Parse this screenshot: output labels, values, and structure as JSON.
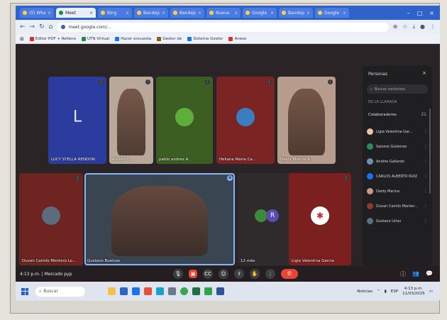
{
  "browser": {
    "tabs": [
      {
        "label": "(5) WhatsA",
        "active": false
      },
      {
        "label": "Meet",
        "active": true
      },
      {
        "label": "Bing",
        "active": false
      },
      {
        "label": "Bandeja",
        "active": false
      },
      {
        "label": "Bandeja",
        "active": false
      },
      {
        "label": "Nueva",
        "active": false
      },
      {
        "label": "Google",
        "active": false
      },
      {
        "label": "Bandeja",
        "active": false
      },
      {
        "label": "Google",
        "active": false
      }
    ],
    "url": "meet.google.com/...",
    "bookmarks": [
      {
        "label": "Editor PDF + Relleno",
        "color": "#d93025"
      },
      {
        "label": "UTN Virtual",
        "color": "#1e8e3e"
      },
      {
        "label": "Hacer encuesta",
        "color": "#1a73e8"
      },
      {
        "label": "Gestor de",
        "color": "#8e5a1e"
      },
      {
        "label": "Sistema Gestor",
        "color": "#1a73e8"
      },
      {
        "label": "Anexo",
        "color": "#d93025"
      }
    ]
  },
  "meet": {
    "participants_grid": [
      {
        "name": "LUCY STELLA RENDON",
        "bg": "#2b3c9e",
        "kind": "letter",
        "letter": "L"
      },
      {
        "name": "Aurelio C...",
        "bg": "#b9a89a",
        "kind": "video"
      },
      {
        "name": "pablo andres A",
        "bg": "#3d5e22",
        "kind": "avatar",
        "avatar_color": "#5fae3a"
      },
      {
        "name": "Heliana Maria Ca...",
        "bg": "#7a2424",
        "kind": "avatar",
        "avatar_color": "#3a7ec0"
      },
      {
        "name": "Deidy Marina R...",
        "bg": "#b79b8d",
        "kind": "video"
      },
      {
        "name": "Duvan Camilo Montero Lo...",
        "bg": "#6e2420",
        "kind": "avatar",
        "avatar_color": "#5b6d7c"
      },
      {
        "name": "Gustavo Buelvas",
        "bg": "#3a4552",
        "kind": "video"
      },
      {
        "name": "12 más",
        "bg": "#2f2a2c",
        "kind": "group"
      },
      {
        "name": "Ligia Valentina Garcia",
        "bg": "#7c1f1f",
        "kind": "logo"
      }
    ],
    "group_letter": "R",
    "time_meeting": "4:13 p.m. | Mercado pyp",
    "hangup_icon": "call-end-icon"
  },
  "panel": {
    "title": "Personas",
    "close": "×",
    "search_placeholder": "Buscar contactos",
    "section": "EN LA LLAMADA",
    "group": "Colaboradores",
    "group_count": "21",
    "people": [
      {
        "name": "Ligia Valentina Gar...",
        "color": "#e8c7a0"
      },
      {
        "name": "Salomé Gutiérrez",
        "color": "#2e8b57"
      },
      {
        "name": "Andrés Gallardo",
        "color": "#6d8fb0"
      },
      {
        "name": "CARLOS ALBERTO RUIZ",
        "color": "#1a73e8"
      },
      {
        "name": "Deidy Marina",
        "color": "#c59a88"
      },
      {
        "name": "Duvan Camilo Monter...",
        "color": "#8a3b2b"
      },
      {
        "name": "Gustavo Urias",
        "color": "#5a6f80"
      }
    ]
  },
  "taskbar": {
    "search": "Buscar",
    "tray_text": "Noticias",
    "lang": "ESP",
    "time": "4:13 p.m.",
    "date": "11/03/2025"
  }
}
